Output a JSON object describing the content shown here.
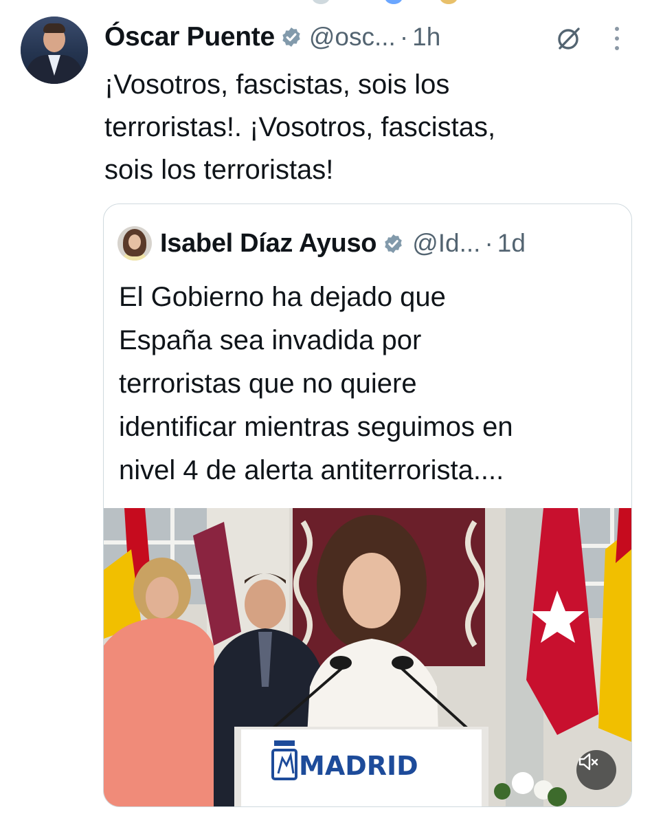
{
  "author": {
    "name": "Óscar Puente",
    "handle": "@osc...",
    "separator": "·",
    "time": "1h",
    "text": "¡Vosotros, fascistas, sois los\nterroristas!. ¡Vosotros, fascistas,\nsois los terroristas!"
  },
  "quoted": {
    "name": "Isabel Díaz Ayuso",
    "handle": "@Id...",
    "separator": "·",
    "time": "1d",
    "text": "El Gobierno ha dejado que\nEspaña sea invadida por\nterroristas que no quiere\nidentificar mientras seguimos en\nnivel 4 de alerta antiterrorista....",
    "media": {
      "podium_sign": "MADRID",
      "mute_icon": "speaker-muted-icon"
    }
  },
  "icons": {
    "verified": "verified-badge-icon",
    "grok": "grok-icon",
    "more": "more-vertical-icon"
  },
  "colors": {
    "verified_badge": "#829aab",
    "secondary_text": "#536471",
    "primary_text": "#0f1419",
    "border": "#cfd9de",
    "madrid_blue": "#1d4b9a"
  }
}
